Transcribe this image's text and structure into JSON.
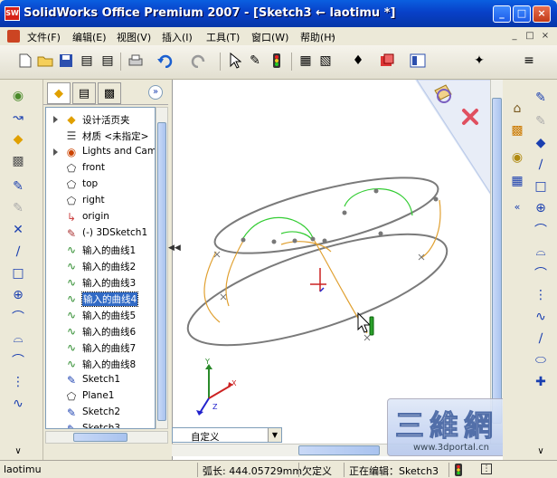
{
  "window": {
    "title": "SolidWorks Office Premium 2007 - [Sketch3 ← laotimu *]",
    "logo": "SW",
    "controls": {
      "minimize": "_",
      "maximize": "□",
      "close": "×"
    }
  },
  "menubar": {
    "items": [
      "文件(F)",
      "编辑(E)",
      "视图(V)",
      "插入(I)",
      "工具(T)",
      "窗口(W)",
      "帮助(H)"
    ],
    "extra": "-",
    "mdi": [
      "_",
      "□",
      "×"
    ]
  },
  "toolbar": {
    "icons": [
      "new-icon",
      "open-icon",
      "save-icon",
      "print-icon",
      "undo-icon",
      "redo-icon",
      "select-icon",
      "rebuild-icon",
      "options-icon"
    ]
  },
  "feature_manager": {
    "tree": [
      {
        "label": "设计活页夹",
        "icon": "folder-icon",
        "expand": true
      },
      {
        "label": "材质 <未指定>",
        "icon": "material-icon",
        "expand": false
      },
      {
        "label": "Lights and Came",
        "icon": "lights-icon",
        "expand": true
      },
      {
        "label": "front",
        "icon": "plane-icon",
        "expand": false
      },
      {
        "label": "top",
        "icon": "plane-icon",
        "expand": false
      },
      {
        "label": "right",
        "icon": "plane-icon",
        "expand": false
      },
      {
        "label": "origin",
        "icon": "origin-icon",
        "expand": false
      },
      {
        "label": "(-) 3DSketch1",
        "icon": "3dsketch-icon",
        "expand": false
      },
      {
        "label": "输入的曲线1",
        "icon": "curve-icon",
        "expand": false
      },
      {
        "label": "输入的曲线2",
        "icon": "curve-icon",
        "expand": false
      },
      {
        "label": "输入的曲线3",
        "icon": "curve-icon",
        "expand": false
      },
      {
        "label": "输入的曲线4",
        "icon": "curve-icon",
        "expand": false,
        "selected": true
      },
      {
        "label": "输入的曲线5",
        "icon": "curve-icon",
        "expand": false
      },
      {
        "label": "输入的曲线6",
        "icon": "curve-icon",
        "expand": false
      },
      {
        "label": "输入的曲线7",
        "icon": "curve-icon",
        "expand": false
      },
      {
        "label": "输入的曲线8",
        "icon": "curve-icon",
        "expand": false
      },
      {
        "label": "Sketch1",
        "icon": "sketch-icon",
        "expand": false
      },
      {
        "label": "Plane1",
        "icon": "plane-icon",
        "expand": false
      },
      {
        "label": "Sketch2",
        "icon": "sketch-icon",
        "expand": false
      },
      {
        "label": "Sketch3",
        "icon": "sketch-icon",
        "expand": false
      }
    ]
  },
  "viewport": {
    "view_select": "自定义",
    "axes": {
      "x": "X",
      "y": "Y",
      "z": "Z"
    }
  },
  "watermark": {
    "main": "三維網",
    "url": "www.3dportal.cn"
  },
  "statusbar": {
    "doc": "laotimu",
    "arc_length": "弧长: 444.05729mm",
    "state": "欠定义",
    "editing": "正在编辑：Sketch3"
  },
  "colors": {
    "title_blue": "#0840c8",
    "selection": "#316ac5",
    "sketch_gray": "#777777",
    "curve_orange": "#e0a030",
    "curve_green": "#33cc33"
  }
}
